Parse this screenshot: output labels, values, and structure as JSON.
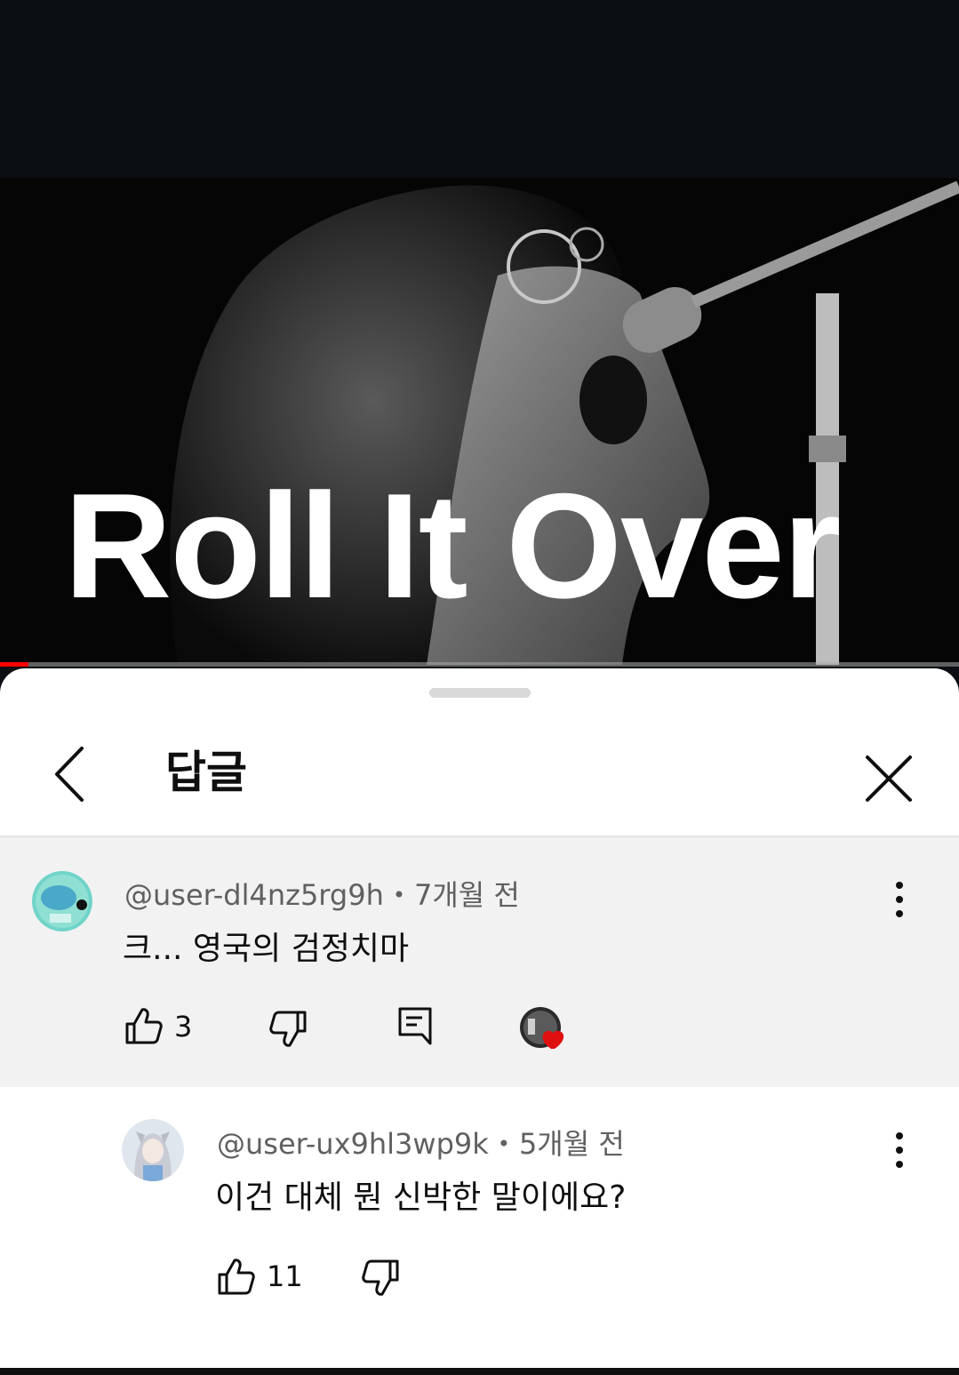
{
  "video": {
    "title": "Roll It Over",
    "progress_percent": 3,
    "accent_color": "#ff0000"
  },
  "sheet": {
    "header": {
      "back_icon": "chevron-left-icon",
      "title": "답글",
      "close_icon": "close-icon"
    }
  },
  "parent_comment": {
    "author": "@user-dl4nz5rg9h",
    "separator": "•",
    "time": "7개월 전",
    "text": "크... 영국의 검정치마",
    "likes": "3",
    "icons": {
      "like": "thumbs-up-icon",
      "dislike": "thumbs-down-icon",
      "reply": "reply-icon",
      "creator_heart": "creator-heart-icon",
      "more": "more-vert-icon"
    }
  },
  "reply": {
    "author": "@user-ux9hl3wp9k",
    "separator": "•",
    "time": "5개월 전",
    "text": "이건 대체 뭔 신박한 말이에요?",
    "likes": "11",
    "icons": {
      "like": "thumbs-up-icon",
      "dislike": "thumbs-down-icon",
      "more": "more-vert-icon"
    }
  }
}
